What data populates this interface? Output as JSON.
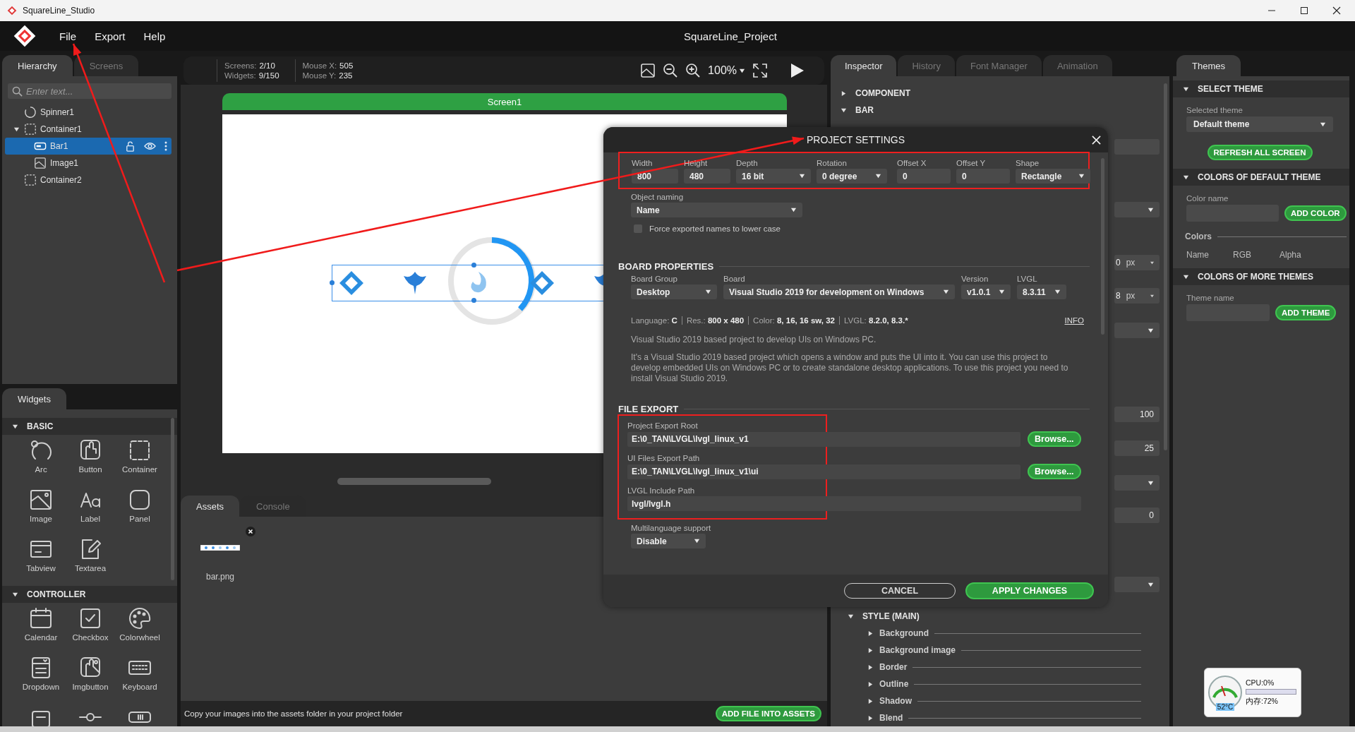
{
  "window": {
    "title": "SquareLine_Studio"
  },
  "menu": [
    "File",
    "Export",
    "Help"
  ],
  "project_title": "SquareLine_Project",
  "hierarchy": {
    "tabs": [
      {
        "label": "Hierarchy",
        "selected": true
      },
      {
        "label": "Screens",
        "selected": false
      }
    ],
    "search_placeholder": "Enter text...",
    "items": [
      {
        "label": "Spinner1",
        "kind": "spinner",
        "selected": false
      },
      {
        "label": "Container1",
        "kind": "container",
        "selected": false,
        "expanded": true,
        "children": [
          {
            "label": "Bar1",
            "kind": "bar",
            "selected": true
          },
          {
            "label": "Image1",
            "kind": "image",
            "selected": false
          }
        ]
      },
      {
        "label": "Container2",
        "kind": "container",
        "selected": false
      }
    ]
  },
  "widgets": {
    "tab": "Widgets",
    "groups": [
      {
        "title": "BASIC",
        "expanded": true,
        "items": [
          {
            "label": "Arc",
            "kind": "arc"
          },
          {
            "label": "Button",
            "kind": "button"
          },
          {
            "label": "Container",
            "kind": "container"
          },
          {
            "label": "Image",
            "kind": "image"
          },
          {
            "label": "Label",
            "kind": "label"
          },
          {
            "label": "Panel",
            "kind": "panel"
          },
          {
            "label": "Tabview",
            "kind": "tabview"
          },
          {
            "label": "Textarea",
            "kind": "textarea"
          }
        ]
      },
      {
        "title": "CONTROLLER",
        "expanded": true,
        "items": [
          {
            "label": "Calendar",
            "kind": "calendar"
          },
          {
            "label": "Checkbox",
            "kind": "checkbox"
          },
          {
            "label": "Colorwheel",
            "kind": "colorwheel"
          },
          {
            "label": "Dropdown",
            "kind": "dropdown"
          },
          {
            "label": "Imgbutton",
            "kind": "imgbutton"
          },
          {
            "label": "Keyboard",
            "kind": "keyboard"
          },
          {
            "kind": "list"
          },
          {
            "kind": "slider"
          },
          {
            "kind": "switch"
          }
        ]
      }
    ]
  },
  "toolbar": {
    "stat_groups": [
      [
        {
          "label": "Screens:",
          "value": "2/10"
        },
        {
          "label": "Widgets:",
          "value": "9/150"
        }
      ],
      [
        {
          "label": "Mouse X:",
          "value": "505"
        },
        {
          "label": "Mouse Y:",
          "value": "235"
        }
      ]
    ],
    "zoom": "100%"
  },
  "canvas": {
    "screen_title": "Screen1"
  },
  "assets": {
    "tabs": [
      {
        "label": "Assets",
        "selected": true
      },
      {
        "label": "Console",
        "selected": false
      }
    ],
    "files": [
      {
        "name": "bar.png"
      }
    ],
    "hint": "Copy your images into the assets folder in your project folder",
    "add_button": "ADD FILE INTO ASSETS"
  },
  "inspector": {
    "tabs": [
      {
        "label": "Inspector",
        "selected": true
      },
      {
        "label": "History",
        "selected": false
      },
      {
        "label": "Font Manager",
        "selected": false
      },
      {
        "label": "Animation",
        "selected": false
      }
    ],
    "sections": [
      {
        "title": "COMPONENT",
        "expanded": false
      },
      {
        "title": "BAR",
        "expanded": true
      }
    ],
    "fields": [
      {
        "kind": "input"
      },
      {
        "kind": "dropdown"
      },
      {
        "kind": "unit",
        "value": "0",
        "unit": "px"
      },
      {
        "kind": "unit",
        "value": "8",
        "unit": "px"
      },
      {
        "kind": "dropdown"
      },
      {
        "kind": "input",
        "value": "100"
      },
      {
        "kind": "input",
        "value": "25"
      },
      {
        "kind": "dropdown"
      },
      {
        "kind": "input",
        "value": "0"
      },
      {
        "kind": "dropdown"
      }
    ],
    "style_title": "STYLE (MAIN)",
    "style_groups": [
      "Background",
      "Background image",
      "Border",
      "Outline",
      "Shadow",
      "Blend"
    ]
  },
  "themes": {
    "tab": "Themes",
    "select": {
      "title": "SELECT THEME",
      "label": "Selected theme",
      "value": "Default theme",
      "button": "REFRESH ALL SCREEN"
    },
    "default_colors": {
      "title": "COLORS OF DEFAULT THEME",
      "field_label": "Color name",
      "button": "ADD COLOR",
      "list_title": "Colors",
      "columns": [
        "Name",
        "RGB",
        "Alpha"
      ]
    },
    "more_themes": {
      "title": "COLORS OF MORE THEMES",
      "field_label": "Theme name",
      "button": "ADD THEME"
    }
  },
  "dialog": {
    "title": "PROJECT SETTINGS",
    "highlighted": true,
    "display_fields": [
      {
        "label": "Width",
        "value": "800",
        "kind": "input"
      },
      {
        "label": "Height",
        "value": "480",
        "kind": "input"
      },
      {
        "label": "Depth",
        "value": "16 bit",
        "kind": "dropdown"
      },
      {
        "label": "Rotation",
        "value": "0 degree",
        "kind": "dropdown"
      },
      {
        "label": "Offset X",
        "value": "0",
        "kind": "input"
      },
      {
        "label": "Offset Y",
        "value": "0",
        "kind": "input"
      },
      {
        "label": "Shape",
        "value": "Rectangle",
        "kind": "dropdown"
      }
    ],
    "object_naming": {
      "label": "Object naming",
      "value": "Name"
    },
    "force_lowercase": {
      "label": "Force exported names to lower case",
      "checked": false
    },
    "board": {
      "title": "BOARD PROPERTIES",
      "fields": [
        {
          "label": "Board Group",
          "value": "Desktop"
        },
        {
          "label": "Board",
          "value": "Visual Studio 2019 for development on Windows"
        },
        {
          "label": "Version",
          "value": "v1.0.1"
        },
        {
          "label": "LVGL",
          "value": "8.3.11"
        }
      ],
      "summary": [
        {
          "label": "Language:",
          "value": "C"
        },
        {
          "label": "Res.:",
          "value": "800 x 480"
        },
        {
          "label": "Color:",
          "value": "8, 16, 16 sw, 32"
        },
        {
          "label": "LVGL:",
          "value": "8.2.0, 8.3.*"
        }
      ],
      "info_link": "INFO",
      "description": "Visual Studio 2019 based project to develop UIs on Windows PC.",
      "details": "It's a Visual Studio 2019 based project which opens a window and puts the UI into it. You can use this project to develop embedded UIs on Windows PC or to create standalone desktop applications. To use this project you need to install Visual Studio 2019."
    },
    "file_export": {
      "title": "FILE EXPORT",
      "highlighted": true,
      "paths": [
        {
          "label": "Project Export Root",
          "value": "E:\\0_TAN\\LVGL\\lvgl_linux_v1",
          "browse": "Browse..."
        },
        {
          "label": "UI Files Export Path",
          "value": "E:\\0_TAN\\LVGL\\lvgl_linux_v1\\ui",
          "browse": "Browse..."
        },
        {
          "label": "LVGL Include Path",
          "value": "lvgl/lvgl.h"
        }
      ]
    },
    "multilanguage": {
      "label": "Multilanguage support",
      "value": "Disable"
    },
    "cancel": "CANCEL",
    "apply": "APPLY CHANGES"
  },
  "annotations": [
    {
      "kind": "arrow"
    },
    {
      "kind": "arrow"
    }
  ],
  "system_monitor": {
    "cpu": "CPU:0%",
    "memory": "内存:72%",
    "temperature": "52°C"
  }
}
